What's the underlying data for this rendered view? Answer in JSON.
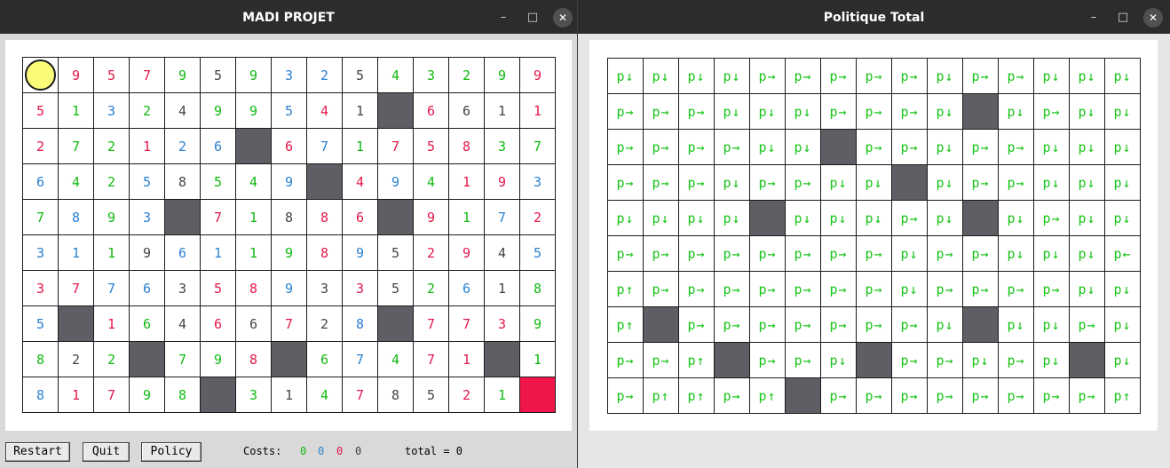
{
  "colors": {
    "1": "#10b910",
    "2": "#e4174a",
    "3": "#2a80cf",
    "4": "#444444",
    "wall": "#5e5f64",
    "goal": "#f0154a",
    "player": "#fbfb7a",
    "policy": "#19c419"
  },
  "left_window": {
    "title": "MADI PROJET",
    "controls": {
      "minimize": "–",
      "maximize": "□",
      "close": "✕"
    },
    "grid": [
      [
        "P",
        "9",
        "5",
        "7",
        "9",
        "5",
        "9",
        "3",
        "2",
        "5",
        "4",
        "3",
        "2",
        "9",
        "9"
      ],
      [
        "5",
        "1",
        "3",
        "2",
        "4",
        "9",
        "9",
        "5",
        "4",
        "1",
        "#",
        "6",
        "6",
        "1",
        "1"
      ],
      [
        "2",
        "7",
        "2",
        "1",
        "2",
        "6",
        "#",
        "6",
        "7",
        "1",
        "7",
        "5",
        "8",
        "3",
        "7"
      ],
      [
        "6",
        "4",
        "2",
        "5",
        "8",
        "5",
        "4",
        "9",
        "#",
        "4",
        "9",
        "4",
        "1",
        "9",
        "3"
      ],
      [
        "7",
        "8",
        "9",
        "3",
        "#",
        "7",
        "1",
        "8",
        "8",
        "6",
        "#",
        "9",
        "1",
        "7",
        "2"
      ],
      [
        "3",
        "1",
        "1",
        "9",
        "6",
        "1",
        "1",
        "9",
        "8",
        "9",
        "5",
        "2",
        "9",
        "4",
        "5"
      ],
      [
        "3",
        "7",
        "7",
        "6",
        "3",
        "5",
        "8",
        "9",
        "3",
        "3",
        "5",
        "2",
        "6",
        "1",
        "8"
      ],
      [
        "5",
        "#",
        "1",
        "6",
        "4",
        "6",
        "6",
        "7",
        "2",
        "8",
        "#",
        "7",
        "7",
        "3",
        "9"
      ],
      [
        "8",
        "2",
        "2",
        "#",
        "7",
        "9",
        "8",
        "#",
        "6",
        "7",
        "4",
        "7",
        "1",
        "#",
        "1"
      ],
      [
        "8",
        "1",
        "7",
        "9",
        "8",
        "#",
        "3",
        "1",
        "4",
        "7",
        "8",
        "5",
        "2",
        "1",
        "G"
      ]
    ],
    "colorgrid": [
      [
        0,
        2,
        2,
        2,
        1,
        4,
        1,
        3,
        3,
        4,
        1,
        1,
        1,
        1,
        2
      ],
      [
        2,
        1,
        3,
        1,
        4,
        1,
        1,
        3,
        2,
        4,
        0,
        2,
        4,
        4,
        2
      ],
      [
        2,
        1,
        1,
        2,
        3,
        3,
        0,
        2,
        3,
        1,
        2,
        2,
        2,
        1,
        1
      ],
      [
        3,
        1,
        1,
        3,
        4,
        1,
        1,
        3,
        0,
        2,
        3,
        1,
        2,
        2,
        3
      ],
      [
        1,
        3,
        1,
        3,
        0,
        2,
        1,
        4,
        2,
        2,
        0,
        2,
        1,
        3,
        2
      ],
      [
        3,
        3,
        1,
        4,
        3,
        3,
        1,
        1,
        2,
        3,
        4,
        2,
        2,
        4,
        3
      ],
      [
        2,
        2,
        3,
        3,
        4,
        2,
        2,
        3,
        4,
        2,
        4,
        1,
        3,
        4,
        1
      ],
      [
        3,
        0,
        2,
        1,
        4,
        2,
        4,
        2,
        4,
        3,
        0,
        2,
        2,
        2,
        1
      ],
      [
        1,
        4,
        1,
        0,
        1,
        1,
        2,
        0,
        1,
        3,
        1,
        2,
        2,
        0,
        1
      ],
      [
        3,
        2,
        2,
        1,
        1,
        0,
        1,
        4,
        1,
        2,
        4,
        4,
        2,
        1,
        0
      ]
    ],
    "buttons": {
      "restart": "Restart",
      "quit": "Quit",
      "policy": "Policy"
    },
    "costs": {
      "label": "Costs:",
      "values": [
        "0",
        "0",
        "0",
        "0"
      ],
      "total": "total = 0"
    }
  },
  "right_window": {
    "title": "Politique Total",
    "controls": {
      "minimize": "–",
      "maximize": "□",
      "close": "✕"
    },
    "policy": [
      [
        "p↓",
        "p↓",
        "p↓",
        "p↓",
        "p→",
        "p→",
        "p→",
        "p→",
        "p→",
        "p↓",
        "p→",
        "p→",
        "p↓",
        "p↓",
        "p↓"
      ],
      [
        "p→",
        "p→",
        "p→",
        "p↓",
        "p↓",
        "p↓",
        "p→",
        "p→",
        "p→",
        "p↓",
        "#",
        "p↓",
        "p→",
        "p↓",
        "p↓"
      ],
      [
        "p→",
        "p→",
        "p→",
        "p→",
        "p↓",
        "p↓",
        "#",
        "p→",
        "p→",
        "p↓",
        "p→",
        "p→",
        "p↓",
        "p↓",
        "p↓"
      ],
      [
        "p→",
        "p→",
        "p→",
        "p↓",
        "p→",
        "p→",
        "p↓",
        "p↓",
        "#",
        "p↓",
        "p→",
        "p→",
        "p↓",
        "p↓",
        "p↓"
      ],
      [
        "p↓",
        "p↓",
        "p↓",
        "p↓",
        "#",
        "p↓",
        "p↓",
        "p↓",
        "p→",
        "p↓",
        "#",
        "p↓",
        "p→",
        "p↓",
        "p↓"
      ],
      [
        "p→",
        "p→",
        "p→",
        "p→",
        "p→",
        "p→",
        "p→",
        "p→",
        "p↓",
        "p→",
        "p→",
        "p↓",
        "p↓",
        "p↓",
        "p←"
      ],
      [
        "p↑",
        "p→",
        "p→",
        "p→",
        "p→",
        "p→",
        "p→",
        "p→",
        "p↓",
        "p→",
        "p→",
        "p→",
        "p→",
        "p↓",
        "p↓"
      ],
      [
        "p↑",
        "#",
        "p→",
        "p→",
        "p→",
        "p→",
        "p→",
        "p→",
        "p→",
        "p↓",
        "#",
        "p↓",
        "p↓",
        "p→",
        "p↓"
      ],
      [
        "p→",
        "p→",
        "p↑",
        "#",
        "p→",
        "p→",
        "p↓",
        "#",
        "p→",
        "p→",
        "p↓",
        "p→",
        "p↓",
        "#",
        "p↓"
      ],
      [
        "p→",
        "p↑",
        "p↑",
        "p→",
        "p↑",
        "#",
        "p→",
        "p→",
        "p→",
        "p→",
        "p→",
        "p→",
        "p→",
        "p→",
        "p↑"
      ]
    ]
  }
}
